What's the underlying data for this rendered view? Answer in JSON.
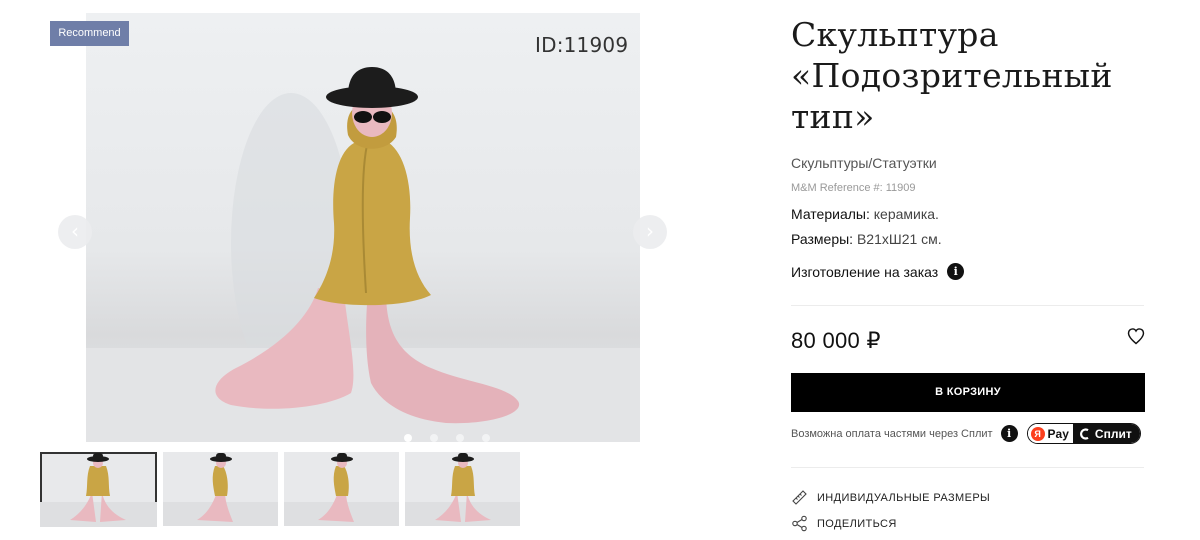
{
  "gallery": {
    "badge": "Recommend",
    "id_label": "ID:11909",
    "prev_glyph": "‹",
    "next_glyph": "›",
    "slide_count": 4,
    "active_slide": 1,
    "thumbnails": [
      {
        "view": "front"
      },
      {
        "view": "side"
      },
      {
        "view": "side"
      },
      {
        "view": "front"
      }
    ]
  },
  "product": {
    "title": "Скульптура «Подозрительный тип»",
    "category": "Скульптуры/Статуэтки",
    "reference": "M&M Reference #: 11909",
    "materials_label": "Материалы:",
    "materials_value": "керамика.",
    "sizes_label": "Размеры:",
    "sizes_value": "В21хШ21 см.",
    "made_to_order": "Изготовление на заказ",
    "price": "80 000 ₽",
    "cart_button": "В КОРЗИНУ",
    "split_text": "Возможна оплата частями через Сплит",
    "pay_label": "Pay",
    "ya_letter": "Я",
    "split_label": "Сплит",
    "info_glyph": "i",
    "individual_sizes": "ИНДИВИДУАЛЬНЫЕ РАЗМЕРЫ",
    "share": "ПОДЕЛИТЬСЯ"
  },
  "colors": {
    "badge_bg": "#6f7ea8",
    "coat": "#c9a545",
    "trousers": "#e9b9c0",
    "hat": "#1c1c1c",
    "button_bg": "#000000"
  },
  "icons": [
    "chevron-left-icon",
    "chevron-right-icon",
    "info-icon",
    "heart-icon",
    "ruler-icon",
    "share-icon",
    "yandex-pay-icon",
    "split-icon"
  ]
}
